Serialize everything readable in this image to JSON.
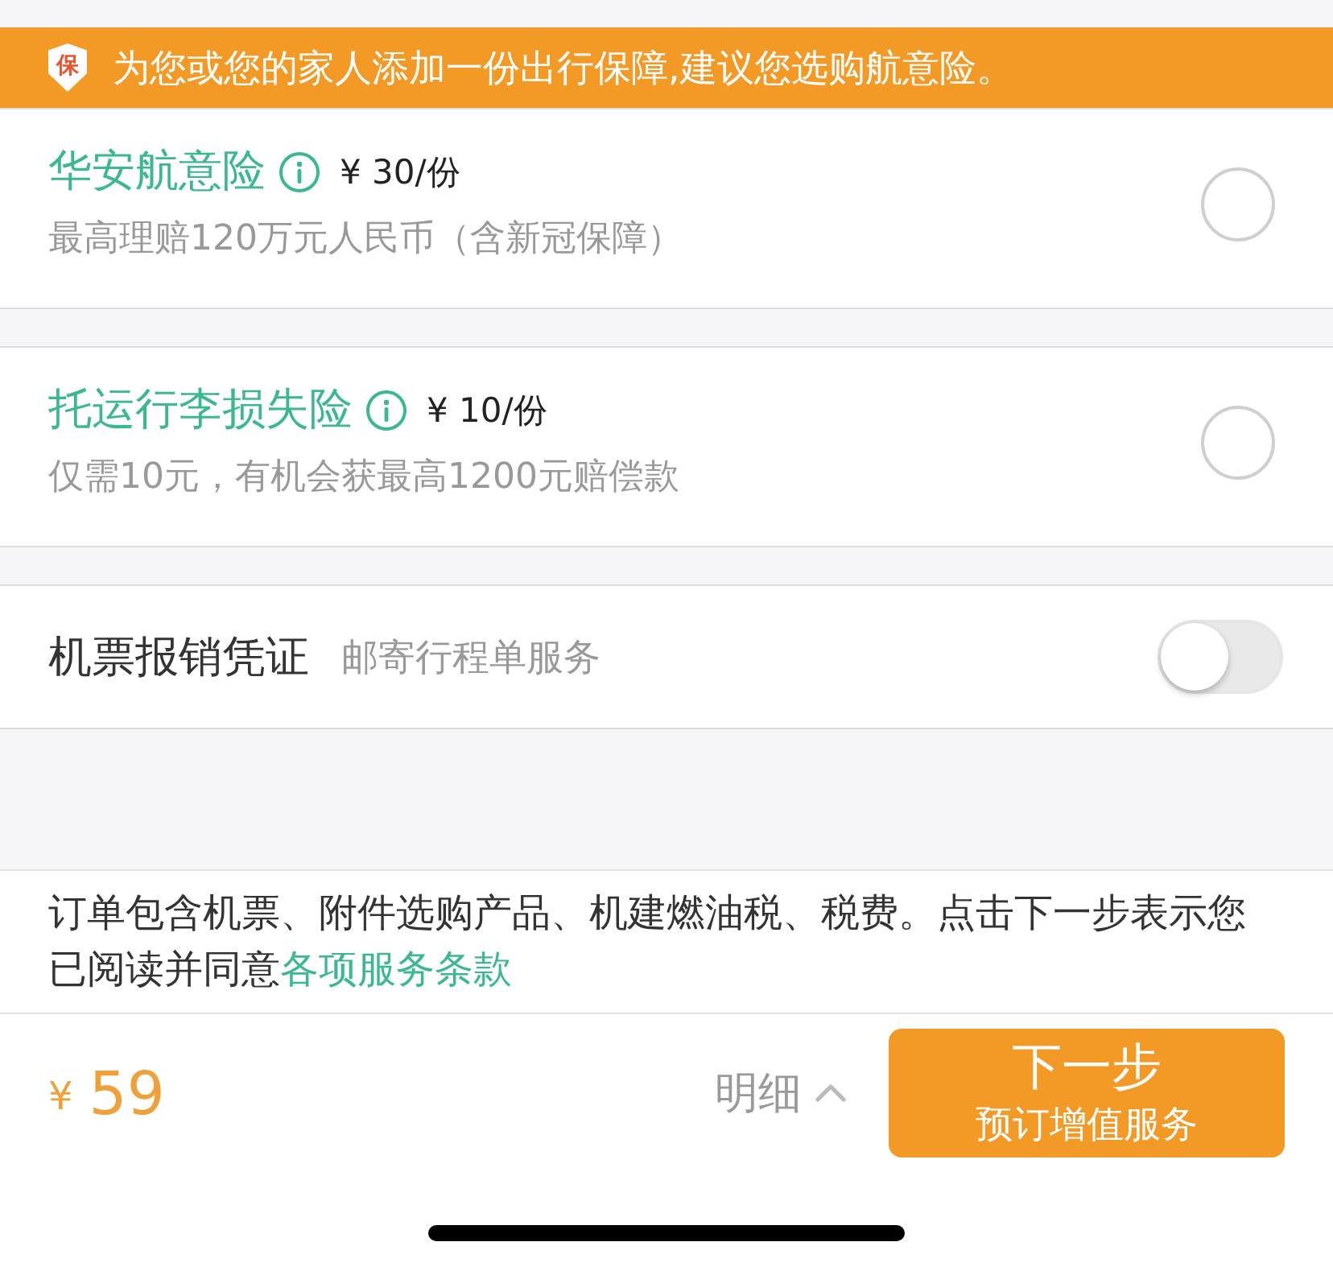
{
  "banner": {
    "badge": "保",
    "text": "为您或您的家人添加一份出行保障,建议您选购航意险。"
  },
  "insurance_options": [
    {
      "name": "华安航意险",
      "price": "¥ 30/份",
      "description": "最高理赔120万元人民币（含新冠保障）",
      "selected": false
    },
    {
      "name": "托运行李损失险",
      "price": "¥ 10/份",
      "description": "仅需10元，有机会获最高1200元赔偿款",
      "selected": false
    }
  ],
  "invoice_option": {
    "label": "机票报销凭证",
    "description": "邮寄行程单服务",
    "on": false
  },
  "notice": {
    "text": "订单包含机票、附件选购产品、机建燃油税、税费。点击下一步表示您已阅读并同意",
    "link": "各项服务条款"
  },
  "footer": {
    "currency": "¥",
    "total": "59",
    "details_label": "明细",
    "button": {
      "title": "下一步",
      "subtitle": "预订增值服务"
    }
  }
}
